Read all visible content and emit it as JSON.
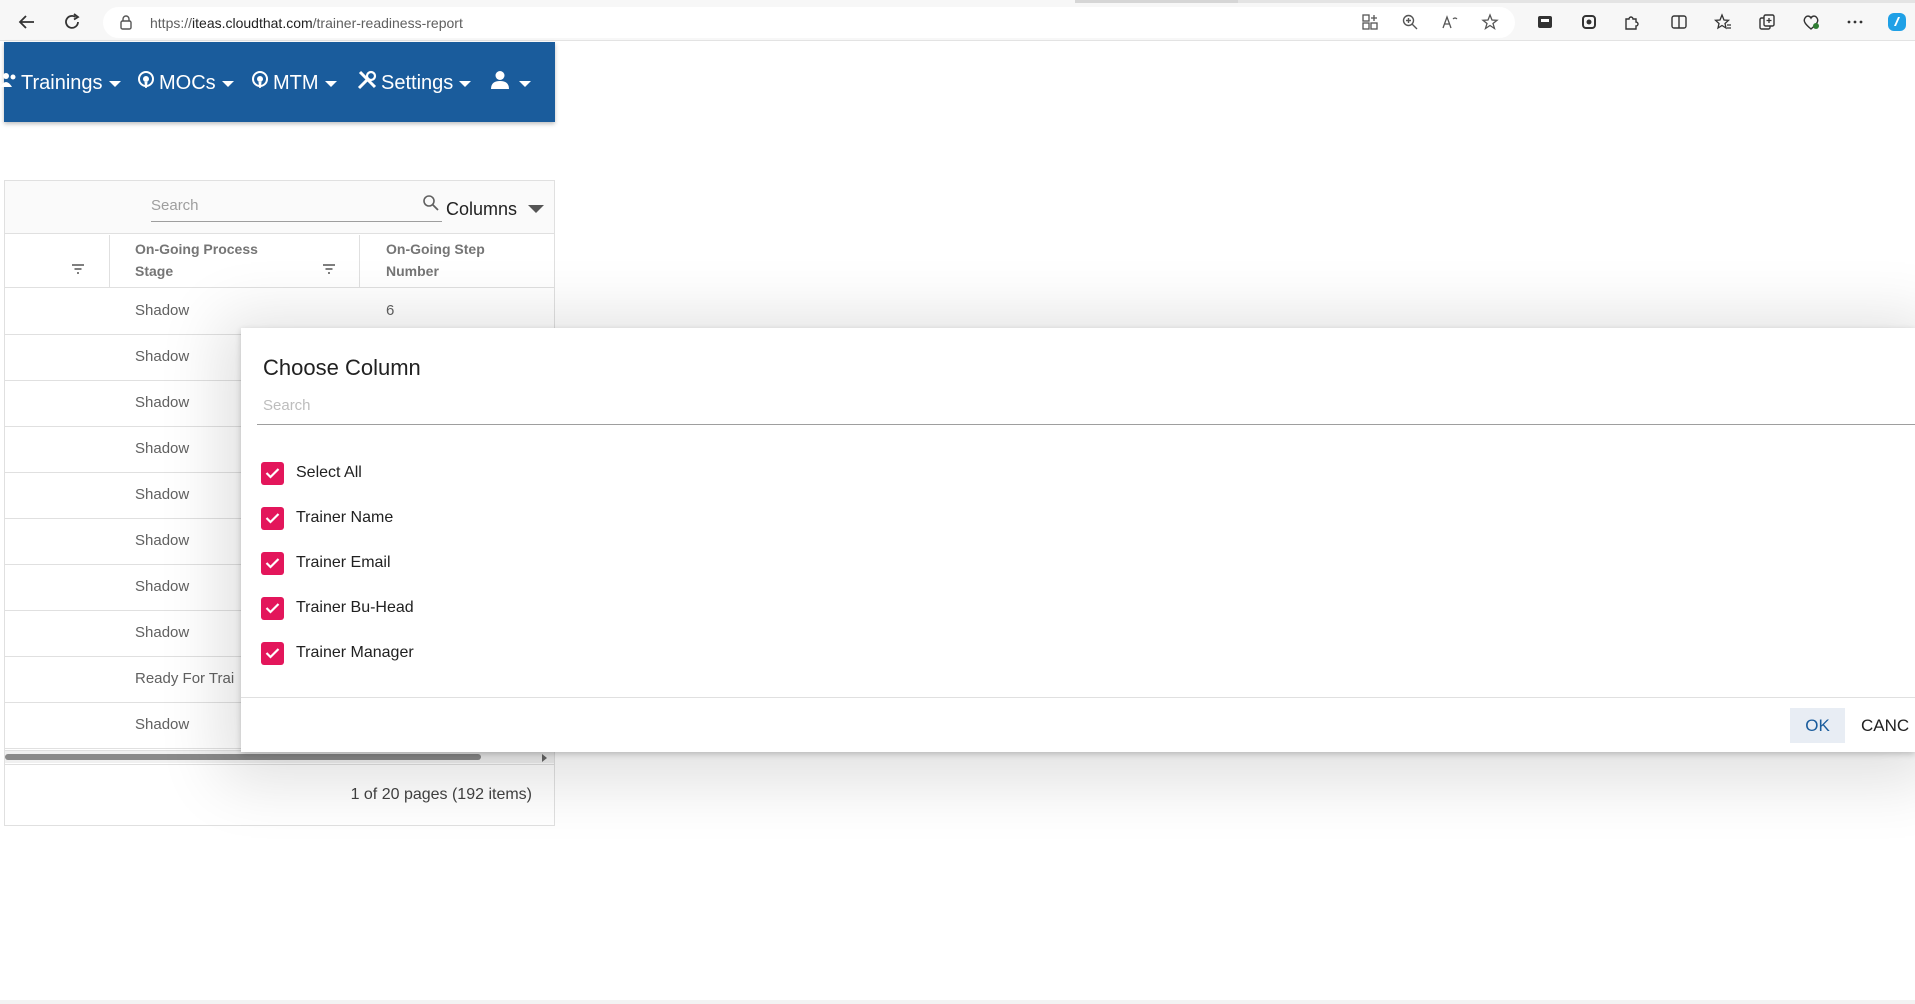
{
  "browser": {
    "url_prefix": "https://",
    "url_host": "iteas.cloudthat.com",
    "url_path": "/trainer-readiness-report"
  },
  "navbar": {
    "items": [
      {
        "label": "Trainings",
        "icon": "users-icon"
      },
      {
        "label": "MOCs",
        "icon": "podcast-icon"
      },
      {
        "label": "MTM",
        "icon": "podcast-icon"
      },
      {
        "label": "Settings",
        "icon": "tools-icon"
      },
      {
        "label": "",
        "icon": "user-icon"
      }
    ]
  },
  "grid": {
    "search_placeholder": "Search",
    "columns_label": "Columns",
    "headers": [
      {
        "line1": "On-Going Process",
        "line2": "Stage"
      },
      {
        "line1": "On-Going Step",
        "line2": "Number"
      }
    ],
    "rows": [
      {
        "stage": "Shadow",
        "step": "6"
      },
      {
        "stage": "Shadow",
        "step": ""
      },
      {
        "stage": "Shadow",
        "step": ""
      },
      {
        "stage": "Shadow",
        "step": ""
      },
      {
        "stage": "Shadow",
        "step": ""
      },
      {
        "stage": "Shadow",
        "step": ""
      },
      {
        "stage": "Shadow",
        "step": ""
      },
      {
        "stage": "Shadow",
        "step": ""
      },
      {
        "stage": "Ready For Trai",
        "step": ""
      },
      {
        "stage": "Shadow",
        "step": ""
      }
    ],
    "pager_text": "1 of 20 pages (192 items)"
  },
  "dialog": {
    "title": "Choose Column",
    "search_placeholder": "Search",
    "options": [
      {
        "label": "Select All",
        "checked": true
      },
      {
        "label": "Trainer Name",
        "checked": true
      },
      {
        "label": "Trainer Email",
        "checked": true
      },
      {
        "label": "Trainer Bu-Head",
        "checked": true
      },
      {
        "label": "Trainer Manager",
        "checked": true
      }
    ],
    "ok_label": "OK",
    "cancel_label": "CANC"
  },
  "colors": {
    "navbar_bg": "#1a5c9c",
    "checkbox": "#e3165b",
    "ok_text": "#1a5c9c"
  }
}
